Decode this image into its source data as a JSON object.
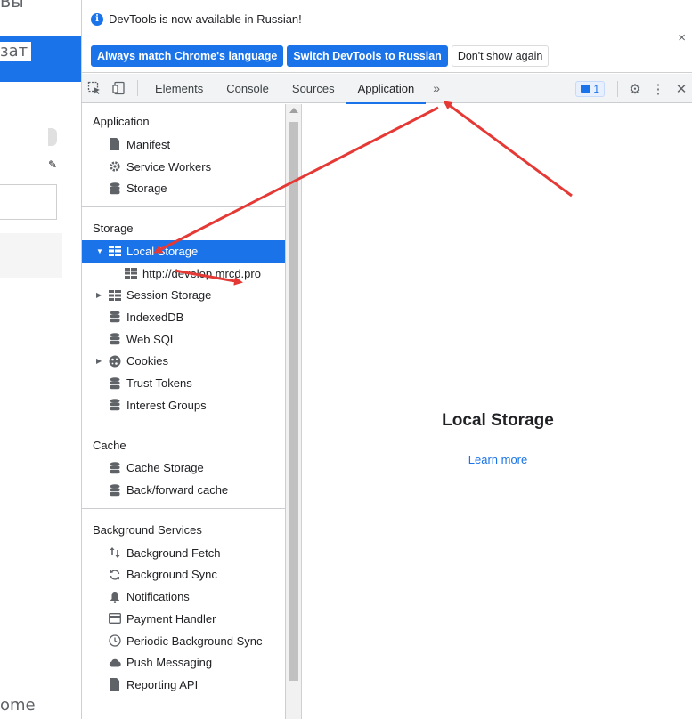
{
  "background_page": {
    "text_top": "Вы",
    "text_mid": "зат",
    "text_bottom": "ome"
  },
  "infobar": {
    "message": "DevTools is now available in Russian!",
    "btn_match": "Always match Chrome's language",
    "btn_switch": "Switch DevTools to Russian",
    "btn_dont_show": "Don't show again",
    "close": "×"
  },
  "tabbar": {
    "tabs": [
      "Elements",
      "Console",
      "Sources",
      "Application"
    ],
    "active_tab": "Application",
    "more": "»",
    "issues_count": "1",
    "settings": "⚙",
    "menu": "⋮",
    "close": "✕"
  },
  "sidebar": {
    "application": {
      "title": "Application",
      "items": [
        "Manifest",
        "Service Workers",
        "Storage"
      ]
    },
    "storage": {
      "title": "Storage",
      "local_storage": "Local Storage",
      "local_origin": "http://develop.mrcd.pro",
      "session_storage": "Session Storage",
      "indexeddb": "IndexedDB",
      "websql": "Web SQL",
      "cookies": "Cookies",
      "trust_tokens": "Trust Tokens",
      "interest_groups": "Interest Groups"
    },
    "cache": {
      "title": "Cache",
      "items": [
        "Cache Storage",
        "Back/forward cache"
      ]
    },
    "background_services": {
      "title": "Background Services",
      "items": [
        "Background Fetch",
        "Background Sync",
        "Notifications",
        "Payment Handler",
        "Periodic Background Sync",
        "Push Messaging",
        "Reporting API"
      ]
    }
  },
  "main": {
    "title": "Local Storage",
    "link": "Learn more"
  },
  "colors": {
    "accent": "#1a73e8",
    "annotation_arrow": "#e53935"
  }
}
